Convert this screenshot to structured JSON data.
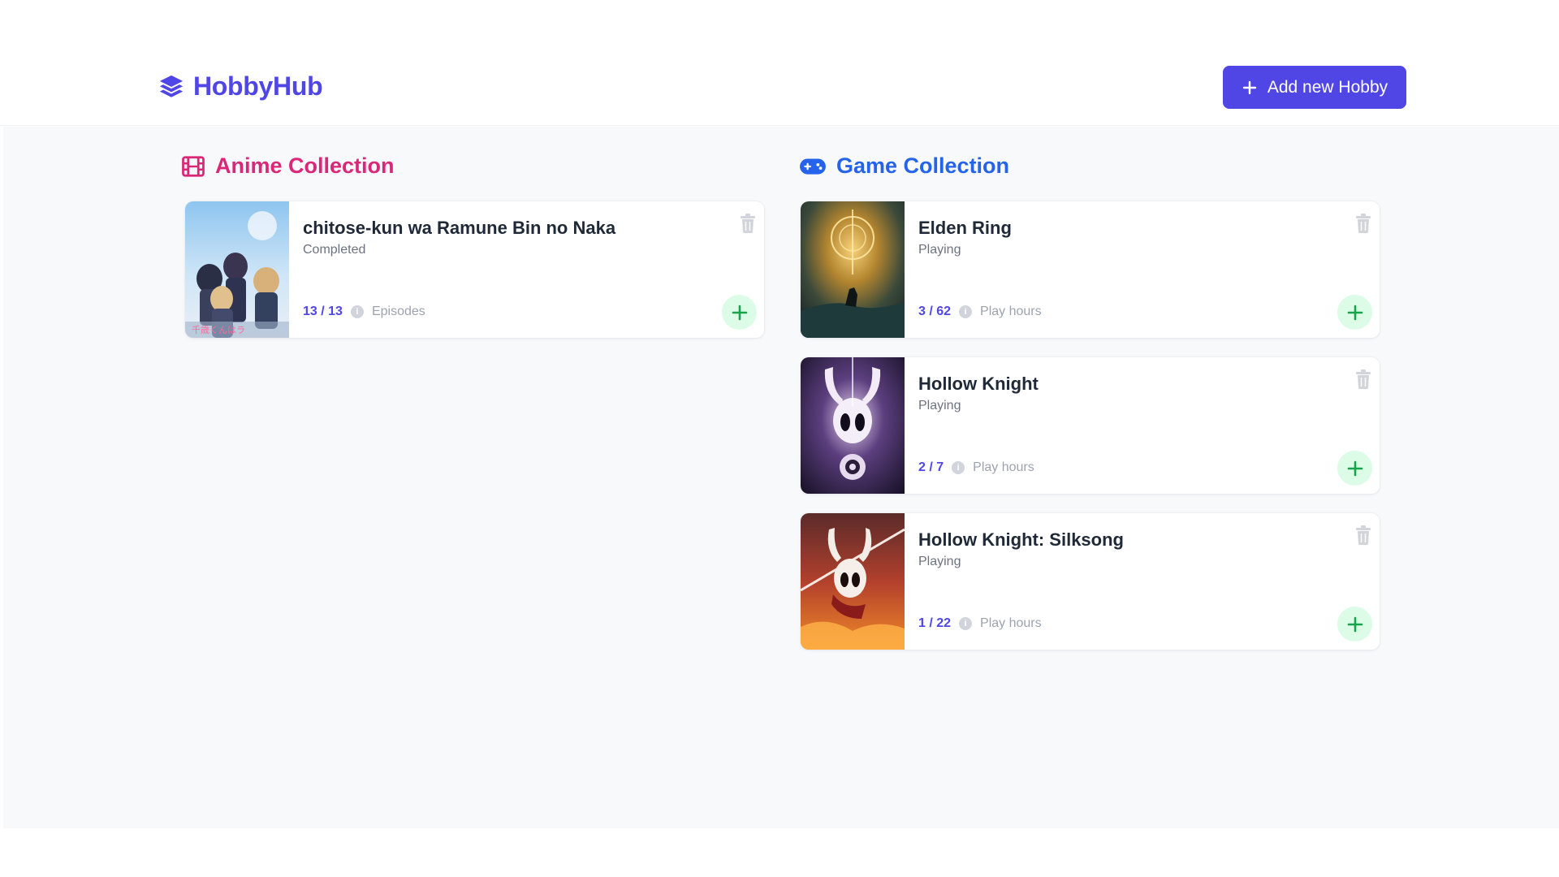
{
  "app": {
    "name": "HobbyHub"
  },
  "header": {
    "add_button_label": "Add new Hobby"
  },
  "colors": {
    "brand": "#4f46e5",
    "anime_accent": "#db2777",
    "game_accent": "#2563eb",
    "plus_bg": "#dcfce7",
    "plus_fg": "#16a34a"
  },
  "anime": {
    "title": "Anime Collection",
    "items": [
      {
        "title": "chitose-kun wa Ramune Bin no Naka",
        "status": "Completed",
        "progress": "13 / 13",
        "unit": "Episodes"
      }
    ]
  },
  "games": {
    "title": "Game Collection",
    "items": [
      {
        "title": "Elden Ring",
        "status": "Playing",
        "progress": "3 / 62",
        "unit": "Play hours"
      },
      {
        "title": "Hollow Knight",
        "status": "Playing",
        "progress": "2 / 7",
        "unit": "Play hours"
      },
      {
        "title": "Hollow Knight: Silksong",
        "status": "Playing",
        "progress": "1 / 22",
        "unit": "Play hours"
      }
    ]
  },
  "icons": {
    "logo": "layers-icon",
    "add": "plus-icon",
    "anime": "film-icon",
    "games": "gamepad-icon",
    "delete": "trash-icon",
    "increment": "plus-icon",
    "info": "info-icon"
  }
}
